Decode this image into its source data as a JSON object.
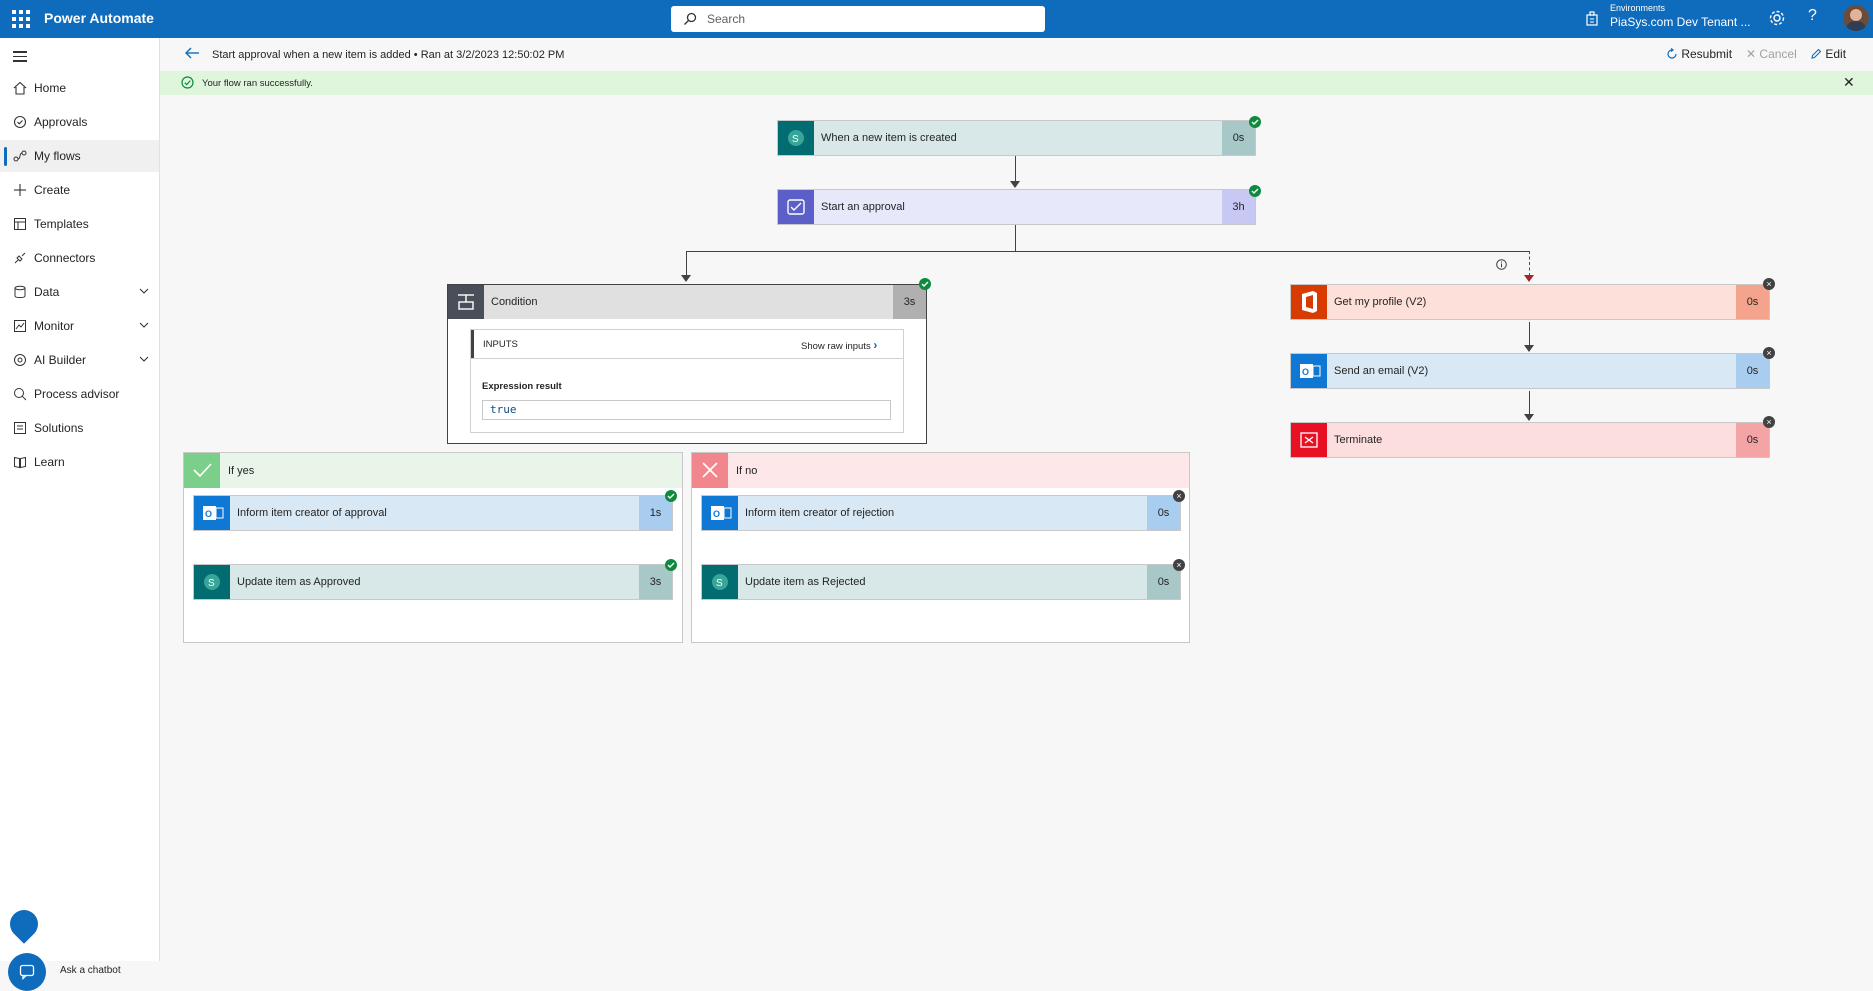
{
  "topbar": {
    "brand": "Power Automate",
    "search_placeholder": "Search",
    "env_label": "Environments",
    "env_name": "PiaSys.com Dev Tenant ...",
    "help_glyph": "?"
  },
  "sidebar": {
    "items": [
      {
        "label": "Home",
        "icon": "home-icon"
      },
      {
        "label": "Approvals",
        "icon": "approvals-icon"
      },
      {
        "label": "My flows",
        "icon": "flows-icon",
        "selected": true
      },
      {
        "label": "Create",
        "icon": "plus-icon"
      },
      {
        "label": "Templates",
        "icon": "templates-icon"
      },
      {
        "label": "Connectors",
        "icon": "connectors-icon"
      },
      {
        "label": "Data",
        "icon": "data-icon",
        "expandable": true
      },
      {
        "label": "Monitor",
        "icon": "monitor-icon",
        "expandable": true
      },
      {
        "label": "AI Builder",
        "icon": "ai-builder-icon",
        "expandable": true
      },
      {
        "label": "Process advisor",
        "icon": "process-advisor-icon"
      },
      {
        "label": "Solutions",
        "icon": "solutions-icon"
      },
      {
        "label": "Learn",
        "icon": "learn-icon"
      }
    ],
    "chatbot_label": "Ask a chatbot"
  },
  "header": {
    "title": "Start approval when a new item is added • Ran at 3/2/2023 12:50:02 PM",
    "resubmit": "Resubmit",
    "cancel": "Cancel",
    "edit": "Edit"
  },
  "banner": {
    "message": "Your flow ran successfully.",
    "close_glyph": "✕"
  },
  "flow": {
    "trigger": {
      "label": "When a new item is created",
      "duration": "0s"
    },
    "approval": {
      "label": "Start an approval",
      "duration": "3h"
    },
    "condition": {
      "label": "Condition",
      "duration": "3s",
      "inputs_label": "INPUTS",
      "raw_inputs": "Show raw inputs",
      "expr_label": "Expression result",
      "expr_value": "true"
    },
    "if_yes": {
      "label": "If yes",
      "steps": [
        {
          "label": "Inform item creator of approval",
          "duration": "1s"
        },
        {
          "label": "Update item as Approved",
          "duration": "3s"
        }
      ]
    },
    "if_no": {
      "label": "If no",
      "steps": [
        {
          "label": "Inform item creator of rejection",
          "duration": "0s"
        },
        {
          "label": "Update item as Rejected",
          "duration": "0s"
        }
      ]
    },
    "parallel": [
      {
        "label": "Get my profile (V2)",
        "duration": "0s"
      },
      {
        "label": "Send an email (V2)",
        "duration": "0s"
      },
      {
        "label": "Terminate",
        "duration": "0s"
      }
    ]
  },
  "colors": {
    "accent": "#0f6cbd",
    "success": "#0e8a3e",
    "sharepoint": "#036c70",
    "approval": "#5b5fc7",
    "outlook": "#0f78d4",
    "office": "#d83b01",
    "terminate": "#e81123"
  }
}
